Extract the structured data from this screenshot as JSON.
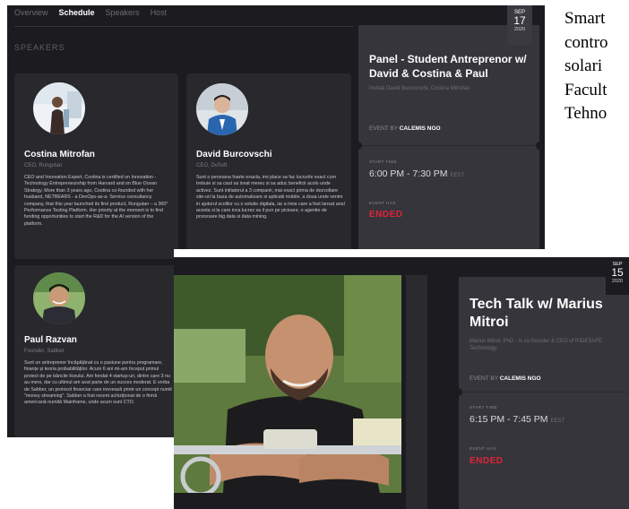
{
  "screenA": {
    "nav": {
      "overview": "Overview",
      "schedule": "Schedule",
      "speakers": "Speakers",
      "host": "Host"
    },
    "section_title": "SPEAKERS",
    "speakers": [
      {
        "name": "Costina Mitrofan",
        "role": "CEO, Rungutan",
        "bio": "CEO and Innovation Expert, Costina is certified on Innovation - Technology Entrepreneurship from Harvard and on Blue Ocean Strategy. More than 3 years ago, Costina co-founded with her husband, NETBEARS - a DevOps-as-a- Service consultancy company, that this year launched its first product, Rungutan – a 360° Performance Testing Platform. Her priority at the moment is to find funding opportunities to start the R&D for the AI version of the platform."
      },
      {
        "name": "David Burcovschi",
        "role": "CEO, DvSoft",
        "bio": "Sunt o persoana foarte exacta, imi place sa fac lucrurile exact cum trebuie si sa caut sa invat mereu si sa aduc beneficii acolo unde activez. Sunt initiatorul a 3 companii, mai exact prima de dezvoltare site-uri la baza de automatizare si aplicatii mobile, a doua unde venim in ajutorul scolilor cu o solutie digitala, iar a treia care a fost lansat anul acesta si la care inca lucrez sa il pun pe picioare, o agentie de procesare big data si data mining."
      },
      {
        "name": "Paul Razvan",
        "role": "Founder, Sabber",
        "bio": "Sunt un antreprenor încăpățânat cu o pasiune pentru programare, finanțe și teoria probabilităților. Acum 6 ani mi-am început primul proiect de pe băncile liceului. Am fondat 4 startup-uri, dintre care 3 nu au mers, dar cu ultimul am avut parte de un succes moderat. E vorba de Sabber, un protocol financiar care inovează printr-un concept numit \"money streaming\". Sabber a fost recent achiziționat de o firmă americană numită Mainframe, unde acum sunt CTO."
      }
    ],
    "event": {
      "date_month": "SEP",
      "date_day": "17",
      "date_year": "2020",
      "title": "Panel - Student Antreprenor w/ David & Costina & Paul",
      "subtitle": "Invitati David Burcovschi, Costina Mitrofan",
      "by_label": "EVENT BY",
      "by_org": "CALEMIS NGO",
      "start_label": "START TIME",
      "time": "6:00 PM - 7:30 PM",
      "tz": "EEST",
      "status_label": "EVENT HAS",
      "status": "ENDED"
    }
  },
  "side_text": {
    "line1": "Smart",
    "line2": "contro",
    "line3": "solari",
    "line4": "Facult",
    "line5": "Tehno"
  },
  "screenB": {
    "event": {
      "date_month": "SEP",
      "date_day": "15",
      "date_year": "2020",
      "title": "Tech Talk w/ Marius Mitroi",
      "subtitle": "Marius Mitroi, PhD - is co-founder & CEO of RIDESAFE Technology.",
      "by_label": "EVENT BY",
      "by_org": "CALEMIS NGO",
      "start_label": "START TIME",
      "time": "6:15 PM - 7:45 PM",
      "tz": "EEST",
      "status_label": "EVENT HAS",
      "status": "ENDED"
    }
  },
  "colors": {
    "accent_red": "#e0243a",
    "panel_dark": "#1c1c20",
    "card": "#28282d",
    "event_panel": "#35353b"
  }
}
